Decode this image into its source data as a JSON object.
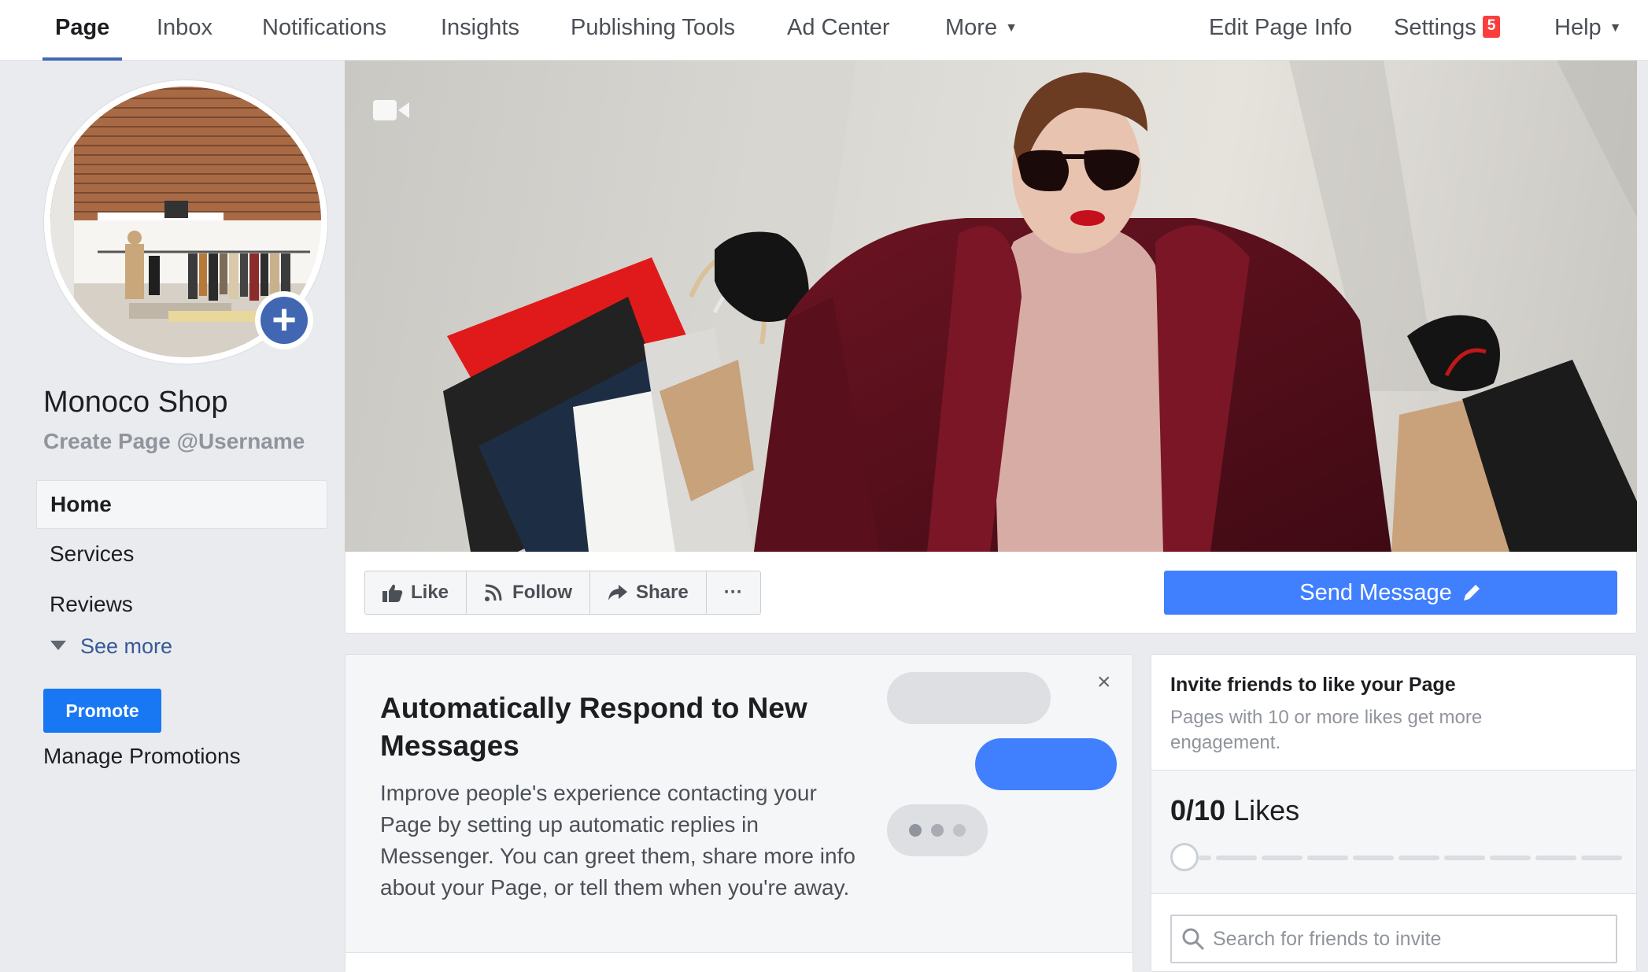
{
  "topnav": {
    "left_items": [
      {
        "label": "Page",
        "active": true
      },
      {
        "label": "Inbox"
      },
      {
        "label": "Notifications"
      },
      {
        "label": "Insights"
      },
      {
        "label": "Publishing Tools"
      },
      {
        "label": "Ad Center"
      },
      {
        "label": "More"
      }
    ],
    "right_items": [
      {
        "label": "Edit Page Info"
      },
      {
        "label": "Settings",
        "badge": "5"
      },
      {
        "label": "Help"
      }
    ]
  },
  "profile": {
    "name": "Monoco Shop",
    "username_link": "Create Page @Username"
  },
  "sidebar": {
    "items": [
      {
        "label": "Home",
        "active": true
      },
      {
        "label": "Services"
      },
      {
        "label": "Reviews"
      }
    ],
    "see_more": "See more",
    "promote": "Promote",
    "manage_promotions": "Manage Promotions"
  },
  "actions": {
    "like": "Like",
    "follow": "Follow",
    "share": "Share",
    "more": "···",
    "send_message": "Send Message"
  },
  "auto_respond": {
    "title": "Automatically Respond to New Messages",
    "body": "Improve people's experience contacting your Page by setting up automatic replies in Messenger. You can greet them, share more info about your Page, or tell them when you're away.",
    "close": "×"
  },
  "invite": {
    "title": "Invite friends to like your Page",
    "subtitle": "Pages with 10 or more likes get more engagement.",
    "likes_count": "0/10",
    "likes_label": "Likes",
    "likes_progress": 0,
    "likes_goal": 10,
    "search_placeholder": "Search for friends to invite"
  },
  "colors": {
    "accent": "#4267b2",
    "send_button": "#4080ff",
    "promote_button": "#1877f2",
    "badge": "#fa3e3e"
  }
}
